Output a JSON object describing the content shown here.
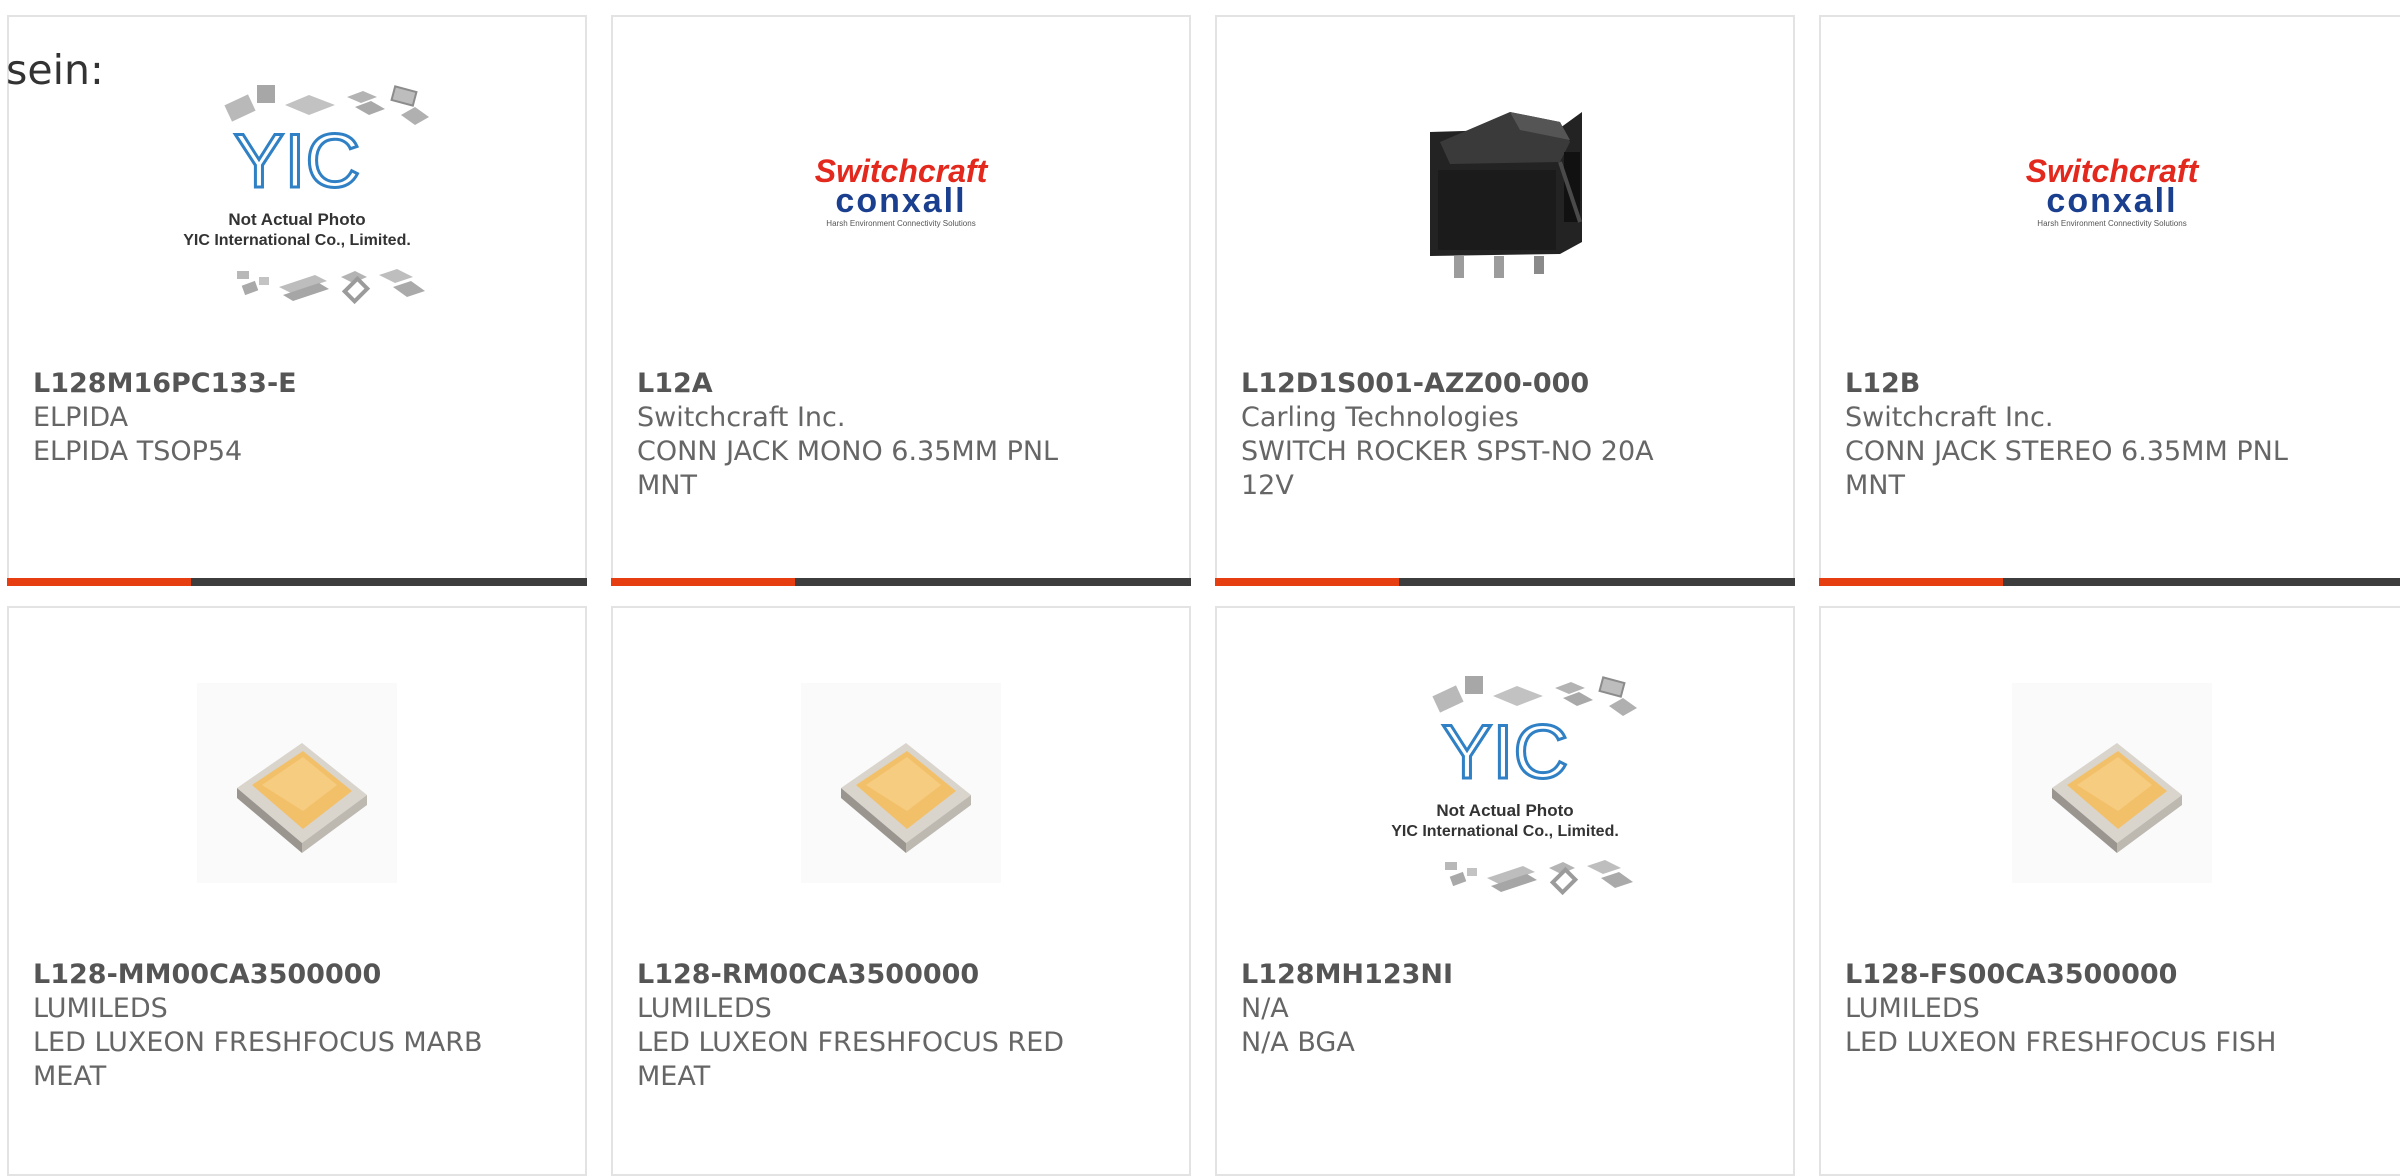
{
  "intro_text": "sein:",
  "colors": {
    "accent": "#e63d11",
    "bar": "#3d3d3d",
    "border": "#e3e3e3",
    "text": "#666666",
    "brand_red": "#e3281d",
    "brand_blue": "#1b3f8f",
    "yic_blue": "#2f80c4"
  },
  "brand_text": {
    "yic_logo": "YIC",
    "yic_line1": "Not Actual Photo",
    "yic_line2": "YIC International Co., Limited.",
    "switchcraft": "Switchcraft",
    "conxall": "conxall",
    "conxall_tagline": "Harsh Environment Connectivity Solutions"
  },
  "products": [
    {
      "part_number": "L128M16PC133-E",
      "manufacturer": "ELPIDA",
      "desc1": "ELPIDA TSOP54",
      "desc2": "",
      "image": "yic-placeholder-icon"
    },
    {
      "part_number": "L12A",
      "manufacturer": "Switchcraft Inc.",
      "desc1": "CONN JACK MONO 6.35MM PNL",
      "desc2": "MNT",
      "image": "switchcraft-conxall-logo"
    },
    {
      "part_number": "L12D1S001-AZZ00-000",
      "manufacturer": "Carling Technologies",
      "desc1": "SWITCH ROCKER SPST-NO 20A",
      "desc2": "12V",
      "image": "rocker-switch-photo"
    },
    {
      "part_number": "L12B",
      "manufacturer": "Switchcraft Inc.",
      "desc1": "CONN JACK STEREO 6.35MM PNL",
      "desc2": "MNT",
      "image": "switchcraft-conxall-logo"
    },
    {
      "part_number": "L128-MM00CA3500000",
      "manufacturer": "LUMILEDS",
      "desc1": "LED LUXEON FRESHFOCUS MARB",
      "desc2": "MEAT",
      "image": "led-chip-photo"
    },
    {
      "part_number": "L128-RM00CA3500000",
      "manufacturer": "LUMILEDS",
      "desc1": "LED LUXEON FRESHFOCUS RED",
      "desc2": "MEAT",
      "image": "led-chip-photo"
    },
    {
      "part_number": "L128MH123NI",
      "manufacturer": "N/A",
      "desc1": "N/A BGA",
      "desc2": "",
      "image": "yic-placeholder-icon"
    },
    {
      "part_number": "L128-FS00CA3500000",
      "manufacturer": "LUMILEDS",
      "desc1": "LED LUXEON FRESHFOCUS FISH",
      "desc2": "",
      "image": "led-chip-photo"
    }
  ]
}
